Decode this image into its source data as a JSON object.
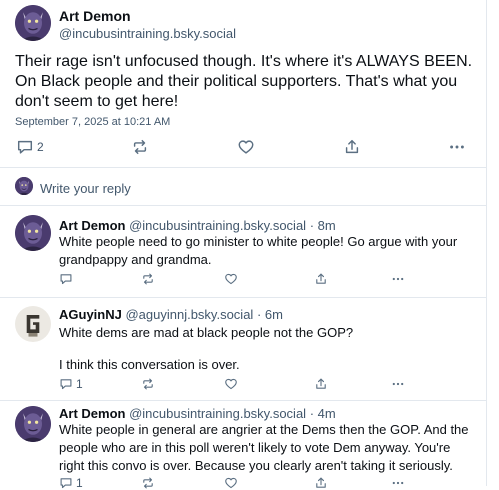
{
  "post": {
    "author_name": "Art Demon",
    "author_handle": "@incubusintraining.bsky.social",
    "text": "Their rage isn't unfocused though. It's where it's ALWAYS BEEN. On Black people and their political supporters. That's what you don't seem to get here!",
    "timestamp": "September 7, 2025 at 10:21 AM",
    "reply_count": "2",
    "icons": [
      "reply-icon",
      "repost-icon",
      "like-icon",
      "share-icon",
      "more-icon"
    ]
  },
  "composer": {
    "placeholder": "Write your reply"
  },
  "replies": [
    {
      "author_name": "Art Demon",
      "author_handle": "@incubusintraining.bsky.social",
      "time": "· 8m",
      "text": "White people need to go minister to white people! Go argue with your grandpappy and grandma.",
      "reply_count": ""
    },
    {
      "author_name": "AGuyinNJ",
      "author_handle": "@aguyinnj.bsky.social",
      "time": "· 6m",
      "text_line1": "White dems are mad at black people not the GOP?",
      "text_line2": "I think this conversation is over.",
      "reply_count": "1"
    },
    {
      "author_name": "Art Demon",
      "author_handle": "@incubusintraining.bsky.social",
      "time": "· 4m",
      "text": "White people in general are angrier at the Dems then the GOP. And the people who are in this poll weren't likely to vote Dem anyway. You're right this convo is over. Because you clearly aren't taking it seriously.",
      "reply_count": "1"
    }
  ]
}
